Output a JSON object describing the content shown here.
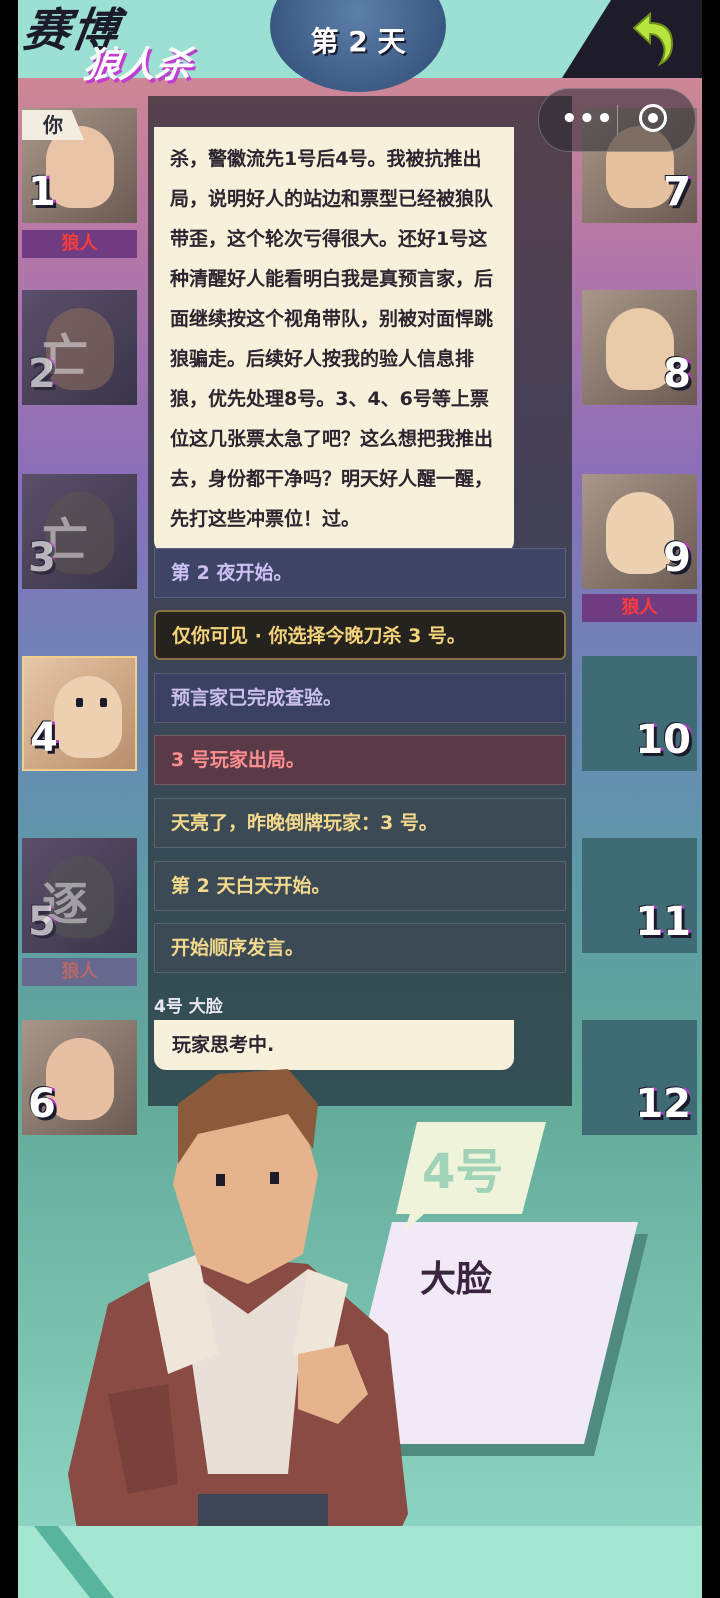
{
  "header": {
    "logo_line1": "赛博",
    "logo_line2": "狼人杀",
    "day_label": "第 2 天"
  },
  "you_tag": "你",
  "players": {
    "p1": {
      "number": "1",
      "role": "狼人"
    },
    "p2": {
      "number": "2",
      "stamp": "亡"
    },
    "p3": {
      "number": "3",
      "stamp": "亡"
    },
    "p4": {
      "number": "4"
    },
    "p5": {
      "number": "5",
      "stamp": "逐",
      "role": "狼人"
    },
    "p6": {
      "number": "6"
    },
    "p7": {
      "number": "7"
    },
    "p8": {
      "number": "8"
    },
    "p9": {
      "number": "9",
      "role": "狼人"
    },
    "p10": {
      "number": "10"
    },
    "p11": {
      "number": "11"
    },
    "p12": {
      "number": "12"
    }
  },
  "chat": {
    "speech": "杀，警徽流先1号后4号。我被抗推出局，说明好人的站边和票型已经被狼队带歪，这个轮次亏得很大。还好1号这种清醒好人能看明白我是真预言家，后面继续按这个视角带队，别被对面悍跳狼骗走。后续好人按我的验人信息排狼，优先处理8号。3、4、6号等上票位这几张票太急了吧？这么想把我推出去，身份都干净吗？明天好人醒一醒，先打这些冲票位！过。",
    "logs": [
      "第 2 夜开始。",
      "仅你可见 · 你选择今晚刀杀 3 号。",
      "预言家已完成查验。",
      "3 号玩家出局。",
      "天亮了，昨晚倒牌玩家：3 号。",
      "第 2 天白天开始。",
      "开始顺序发言。"
    ],
    "speaker_label": "4号 大脸",
    "thinking": "玩家思考中."
  },
  "current_speaker": {
    "number_flag": "4号",
    "name": "大脸"
  }
}
